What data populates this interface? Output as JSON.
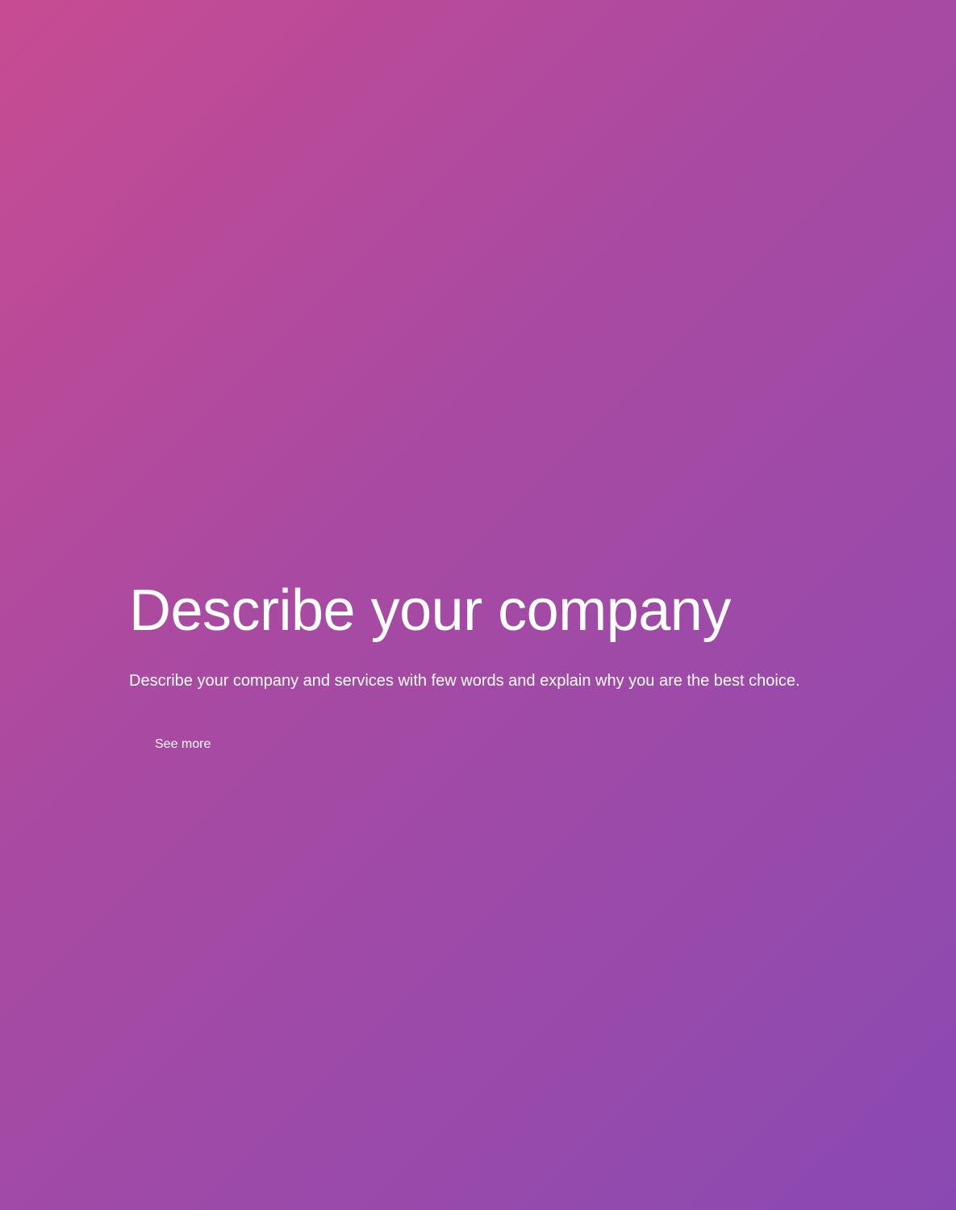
{
  "hero": {
    "title": "Describe your company",
    "subtitle": "Describe your company and services with few words and explain why you are the best choice.",
    "button_label": "See more"
  },
  "colors": {
    "gradient_start": "#c74b92",
    "gradient_end": "#8a49b2",
    "text": "#ffffff"
  }
}
